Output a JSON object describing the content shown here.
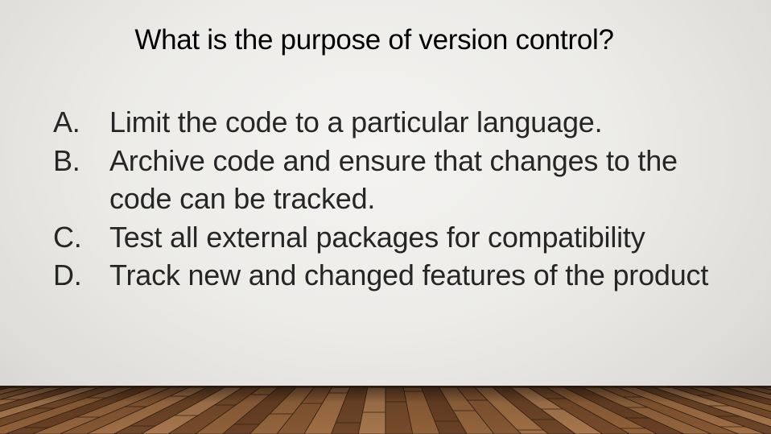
{
  "slide": {
    "title": "What is the purpose of version control?",
    "answers": [
      {
        "letter": "A.",
        "text": "Limit the code to a particular language."
      },
      {
        "letter": "B.",
        "text": "Archive code and ensure that changes to the code can be tracked."
      },
      {
        "letter": "C.",
        "text": "Test all external packages for compatibility"
      },
      {
        "letter": "D.",
        "text": "Track new and changed features of the product"
      }
    ]
  },
  "colors": {
    "background": "#ebeae7",
    "title_text": "#000000",
    "body_text": "#262626",
    "floor_wood": "#8a5a36",
    "floor_dark": "#3a2414"
  }
}
